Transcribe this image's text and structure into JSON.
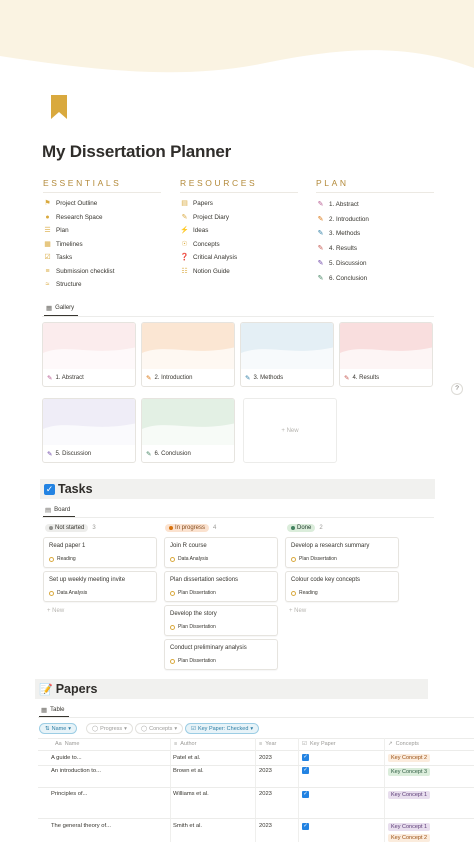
{
  "page": {
    "title": "My Dissertation Planner",
    "colors": {
      "cover": "#faf3e2",
      "accent": "#b38a3a",
      "bookmark": "#d9a93e"
    }
  },
  "essentials": {
    "heading": "ESSENTIALS",
    "items": [
      {
        "icon": "flag-icon",
        "label": "Project Outline"
      },
      {
        "icon": "globe-icon",
        "label": "Research Space"
      },
      {
        "icon": "list-icon",
        "label": "Plan"
      },
      {
        "icon": "calendar-icon",
        "label": "Timelines"
      },
      {
        "icon": "tasks-icon",
        "label": "Tasks"
      },
      {
        "icon": "checklist-icon",
        "label": "Submission checklist"
      },
      {
        "icon": "structure-icon",
        "label": "Structure"
      }
    ]
  },
  "resources": {
    "heading": "RESOURCES",
    "items": [
      {
        "icon": "papers-icon",
        "label": "Papers"
      },
      {
        "icon": "pencil-icon",
        "label": "Project Diary"
      },
      {
        "icon": "lightning-icon",
        "label": "Ideas"
      },
      {
        "icon": "bulb-icon",
        "label": "Concepts"
      },
      {
        "icon": "question-icon",
        "label": "Critical Analysis"
      },
      {
        "icon": "guide-icon",
        "label": "Notion Guide"
      }
    ]
  },
  "plan": {
    "heading": "PLAN",
    "items": [
      {
        "icon": "edit-icon",
        "label": "1. Abstract"
      },
      {
        "icon": "edit-icon",
        "label": "2. Introduction"
      },
      {
        "icon": "edit-icon",
        "label": "3. Methods"
      },
      {
        "icon": "edit-icon",
        "label": "4. Results"
      },
      {
        "icon": "edit-icon",
        "label": "5. Discussion"
      },
      {
        "icon": "edit-icon",
        "label": "6. Conclusion"
      }
    ]
  },
  "gallery": {
    "tab_label": "Gallery",
    "cards": [
      {
        "label": "1. Abstract",
        "color": "#fbeced"
      },
      {
        "label": "2. Introduction",
        "color": "#fbe6d3"
      },
      {
        "label": "3. Methods",
        "color": "#e4eff5"
      },
      {
        "label": "4. Results",
        "color": "#f9dede"
      },
      {
        "label": "5. Discussion",
        "color": "#efedf7"
      },
      {
        "label": "6. Conclusion",
        "color": "#e3f0e4"
      }
    ],
    "new_label": "+ New"
  },
  "help_label": "?",
  "tasks": {
    "title": "Tasks",
    "tab_label": "Board",
    "columns": [
      {
        "status": "Not started",
        "count": "3",
        "pill": "#ededeb",
        "dot": "#91918e",
        "text": "#37352f",
        "cards": [
          {
            "title": "Read paper 1",
            "tag": "Reading"
          },
          {
            "title": "Set up weekly meeting invite",
            "tag": "Data Analysis"
          }
        ],
        "new_label": "+ New"
      },
      {
        "status": "In progress",
        "count": "4",
        "pill": "#fbe2cf",
        "dot": "#d9730d",
        "text": "#854c1d",
        "cards": [
          {
            "title": "Join R course",
            "tag": "Data Analysis"
          },
          {
            "title": "Plan dissertation sections",
            "tag": "Plan Dissertation"
          },
          {
            "title": "Develop the story",
            "tag": "Plan Dissertation"
          },
          {
            "title": "Conduct preliminary analysis",
            "tag": "Plan Dissertation"
          }
        ]
      },
      {
        "status": "Done",
        "count": "2",
        "pill": "#dbeddb",
        "dot": "#448361",
        "text": "#1c3829",
        "cards": [
          {
            "title": "Develop a research summary",
            "tag": "Plan Dissertation"
          },
          {
            "title": "Colour code key concepts",
            "tag": "Reading"
          }
        ],
        "new_label": "+ New"
      }
    ]
  },
  "papers": {
    "title": "Papers",
    "tab_label": "Table",
    "filters": {
      "name": "Name",
      "progress": "Progress",
      "concepts": "Concepts",
      "key_paper": "Key Paper: Checked"
    },
    "headers": {
      "name": "Name",
      "author": "Author",
      "year": "Year",
      "key_paper": "Key Paper",
      "concepts": "Concepts"
    },
    "rows": [
      {
        "name": "A guide to...",
        "author": "Patel et al.",
        "year": "2023",
        "checked": true,
        "concepts": [
          {
            "label": "Key Concept 2",
            "bg": "#fbecdd",
            "fg": "#9a4f12"
          }
        ]
      },
      {
        "name": "An introduction to...",
        "author": "Brown et al.",
        "year": "2023",
        "checked": true,
        "concepts": [
          {
            "label": "Key Concept 3",
            "bg": "#dbeddb",
            "fg": "#2b593f"
          }
        ]
      },
      {
        "name": "Principles of...",
        "author": "Williams et al.",
        "year": "2023",
        "checked": true,
        "concepts": [
          {
            "label": "Key Concept 1",
            "bg": "#e8deee",
            "fg": "#5a3a75"
          }
        ]
      },
      {
        "name": "The general theory of...",
        "author": "Smith et al.",
        "year": "2023",
        "checked": true,
        "concepts": [
          {
            "label": "Key Concept 1",
            "bg": "#e8deee",
            "fg": "#5a3a75"
          },
          {
            "label": "Key Concept 2",
            "bg": "#fbecdd",
            "fg": "#9a4f12"
          }
        ]
      }
    ]
  }
}
